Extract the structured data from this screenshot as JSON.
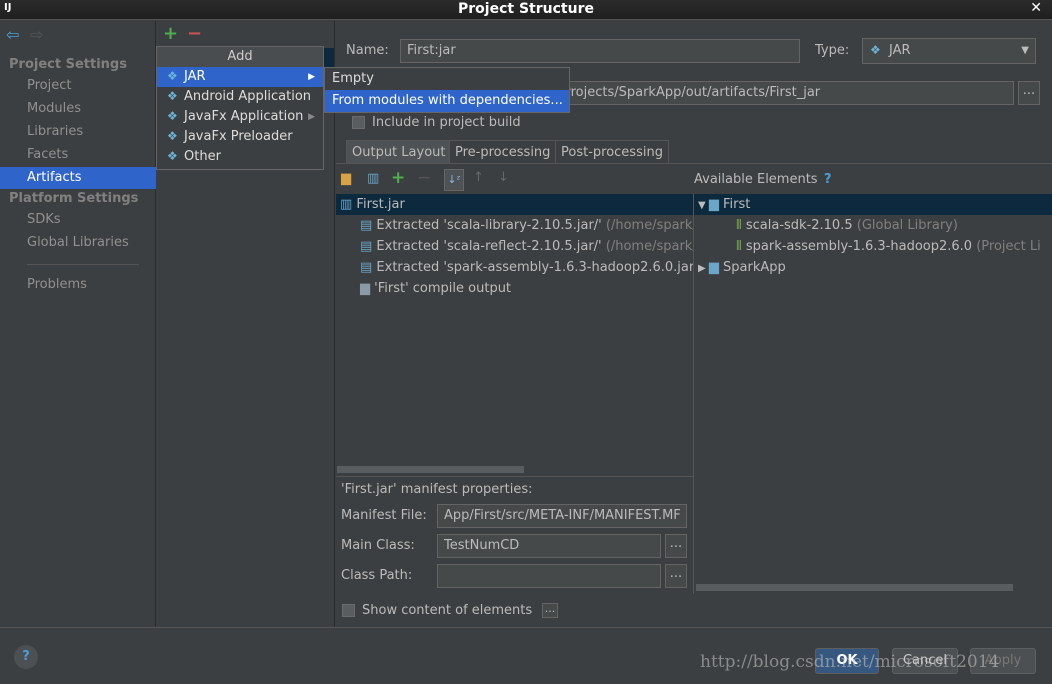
{
  "window": {
    "title": "Project Structure",
    "app_icon": "IJ"
  },
  "sidebar": {
    "sections": [
      {
        "label": "Project Settings",
        "items": [
          "Project",
          "Modules",
          "Libraries",
          "Facets",
          "Artifacts"
        ]
      },
      {
        "label": "Platform Settings",
        "items": [
          "SDKs",
          "Global Libraries"
        ]
      }
    ],
    "problems": "Problems",
    "selected": "Artifacts"
  },
  "add_popup": {
    "title": "Add",
    "items": [
      "JAR",
      "Android Application",
      "JavaFx Application",
      "JavaFx Preloader",
      "Other"
    ],
    "selected": "JAR"
  },
  "jar_submenu": {
    "items": [
      "Empty",
      "From modules with dependencies..."
    ],
    "selected": "From modules with dependencies..."
  },
  "form": {
    "name_label": "Name:",
    "name_value": "First:jar",
    "type_label": "Type:",
    "type_value": "JAR",
    "output_dir": "eaProjects/SparkApp/out/artifacts/First_jar",
    "include_label": "Include in project build",
    "include_checked": false
  },
  "tabs": [
    "Output Layout",
    "Pre-processing",
    "Post-processing"
  ],
  "selected_tab": "Output Layout",
  "layout_tree": [
    {
      "text": "First.jar",
      "extra": ""
    },
    {
      "text": "Extracted 'scala-library-2.10.5.jar/'",
      "extra": " (/home/spark/."
    },
    {
      "text": "Extracted 'scala-reflect-2.10.5.jar/'",
      "extra": " (/home/spark/."
    },
    {
      "text": "Extracted 'spark-assembly-1.6.3-hadoop2.6.0.jar",
      "extra": ""
    },
    {
      "text": "'First' compile output",
      "extra": ""
    }
  ],
  "available": {
    "label": "Available Elements",
    "help": "?",
    "items": [
      {
        "text": "First",
        "extra": ""
      },
      {
        "text": "scala-sdk-2.10.5",
        "extra": " (Global Library)"
      },
      {
        "text": "spark-assembly-1.6.3-hadoop2.6.0",
        "extra": " (Project Li"
      },
      {
        "text": "SparkApp",
        "extra": ""
      }
    ]
  },
  "manifest": {
    "title": "'First.jar' manifest properties:",
    "file_label": "Manifest File:",
    "file_value": "App/First/src/META-INF/MANIFEST.MF",
    "main_label": "Main Class:",
    "main_value": "TestNumCD",
    "cp_label": "Class Path:",
    "cp_value": ""
  },
  "show_content": "Show content of elements",
  "ellipsis": "...",
  "buttons": {
    "ok": "OK",
    "cancel": "Cancel",
    "apply": "Apply"
  },
  "watermark": "http://blog.csdn.net/microsoft2014"
}
